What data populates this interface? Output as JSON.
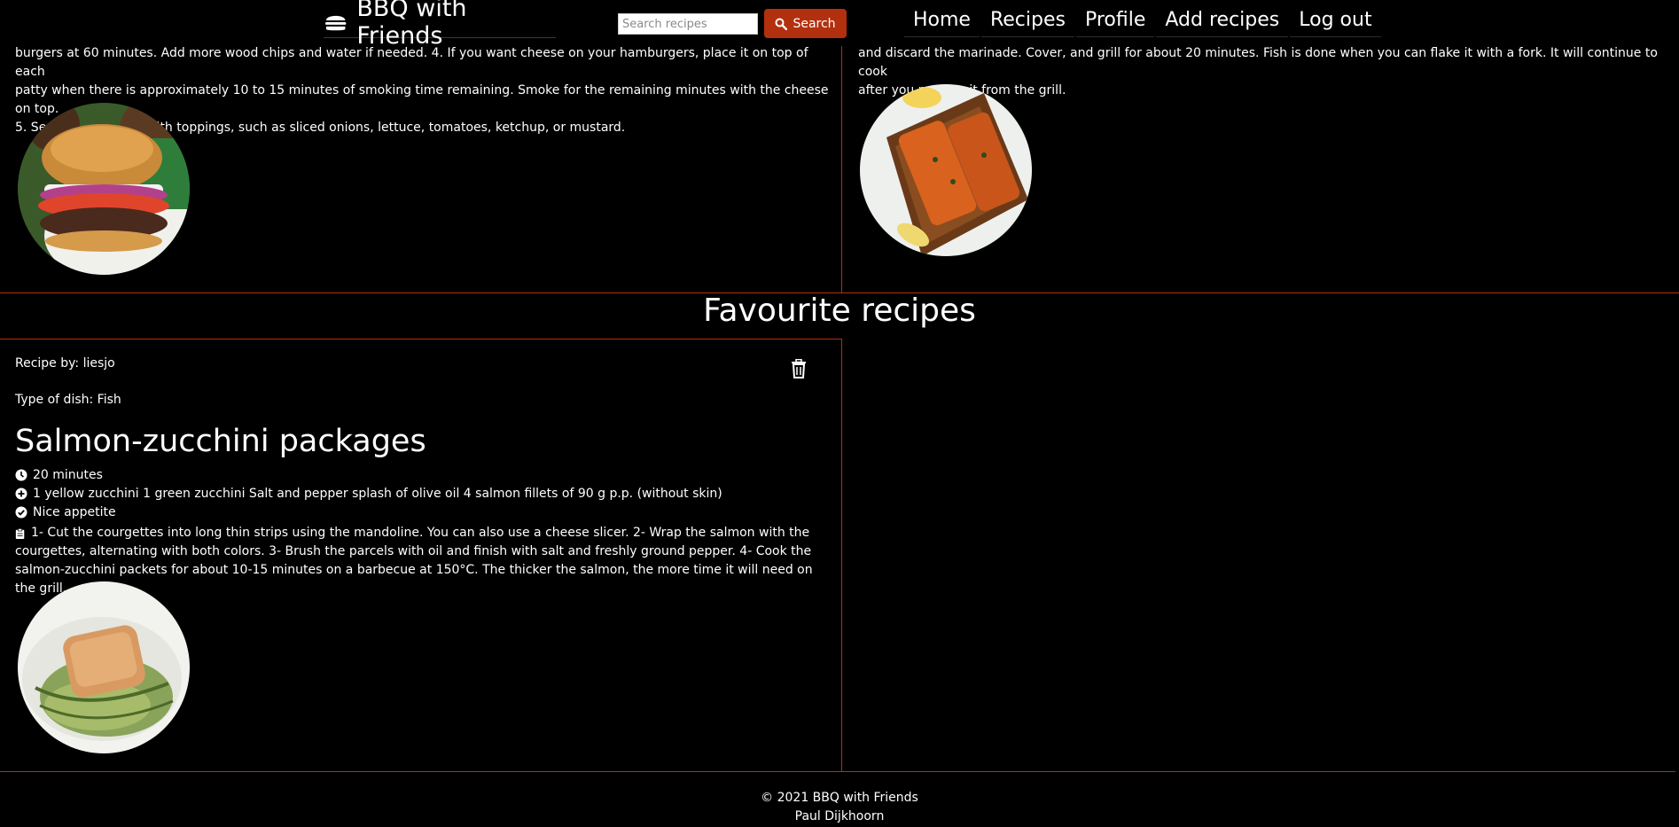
{
  "header": {
    "brand": "BBQ with Friends",
    "search_placeholder": "Search recipes",
    "search_label": "Search",
    "nav": [
      "Home",
      "Recipes",
      "Profile",
      "Add recipes",
      "Log out"
    ]
  },
  "top_cards": {
    "left_text_line1": "burgers at 60 minutes. Add more wood chips and water if needed. 4. If you want cheese on your hamburgers, place it on top of each",
    "left_text_line2": "patty when there is approximately 10 to 15 minutes of smoking time remaining. Smoke for the remaining minutes with the cheese on top.",
    "left_text_line3": "5. Serve the burgers with toppings, such as sliced onions, lettuce, tomatoes, ketchup, or mustard.",
    "right_text_line1": "and discard the marinade. Cover, and grill for about 20 minutes. Fish is done when you can flake it with a fork. It will continue to cook",
    "right_text_line2": "after you remove it from the grill."
  },
  "favourites": {
    "title": "Favourite recipes",
    "recipe": {
      "author": "Recipe by: liesjo",
      "dish_type": "Type of dish: Fish",
      "name": "Salmon-zucchini packages",
      "time": "20 minutes",
      "ingredients": "1 yellow zucchini 1 green zucchini Salt and pepper splash of olive oil 4 salmon fillets of 90 g p.p. (without skin)",
      "closing": "Nice appetite",
      "steps_line1": "1- Cut the courgettes into long thin strips using the mandoline. You can also use a cheese slicer. 2- Wrap the salmon with the",
      "steps_line2": "courgettes, alternating with both colors. 3- Brush the parcels with oil and finish with salt and freshly ground pepper. 4- Cook the",
      "steps_line3": "salmon-zucchini packets for about 10-15 minutes on a barbecue at 150°C. The thicker the salmon, the more time it will need on the grill."
    }
  },
  "footer": {
    "copyright": "© 2021 BBQ with Friends",
    "author": "Paul Dijkhoorn"
  },
  "colors": {
    "accent": "#b3300f",
    "background": "#000000",
    "text": "#ffffff"
  },
  "icons": [
    "burger-icon",
    "search-icon",
    "clock-icon",
    "plus-circle-icon",
    "check-circle-icon",
    "clipboard-icon",
    "trash-icon"
  ]
}
